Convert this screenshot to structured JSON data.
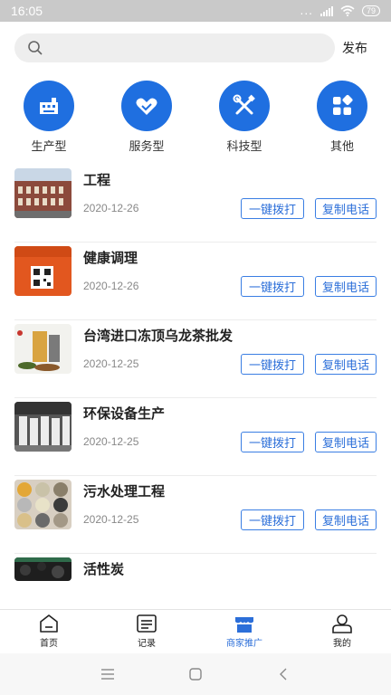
{
  "status_bar": {
    "time": "16:05",
    "dots": "...",
    "battery": "79"
  },
  "search": {
    "placeholder": "",
    "publish_label": "发布"
  },
  "categories": [
    {
      "label": "生产型",
      "icon": "factory-icon"
    },
    {
      "label": "服务型",
      "icon": "heart-hands-icon"
    },
    {
      "label": "科技型",
      "icon": "tools-icon"
    },
    {
      "label": "其他",
      "icon": "grid-icon"
    }
  ],
  "list": {
    "call_label": "一键拨打",
    "copy_label": "复制电话",
    "items": [
      {
        "title": "工程",
        "date": "2020-12-26"
      },
      {
        "title": "健康调理",
        "date": "2020-12-26"
      },
      {
        "title": "台湾进口冻顶乌龙茶批发",
        "date": "2020-12-25"
      },
      {
        "title": "环保设备生产",
        "date": "2020-12-25"
      },
      {
        "title": "污水处理工程",
        "date": "2020-12-25"
      },
      {
        "title": "活性炭",
        "date": ""
      }
    ]
  },
  "bottom_nav": [
    {
      "label": "首页",
      "icon": "home-icon"
    },
    {
      "label": "记录",
      "icon": "list-icon"
    },
    {
      "label": "商家推广",
      "icon": "shop-icon"
    },
    {
      "label": "我的",
      "icon": "user-icon"
    }
  ],
  "colors": {
    "accent": "#1f6fe0",
    "button_text": "#2c6fd9",
    "status_bar": "#c9c9c9"
  }
}
